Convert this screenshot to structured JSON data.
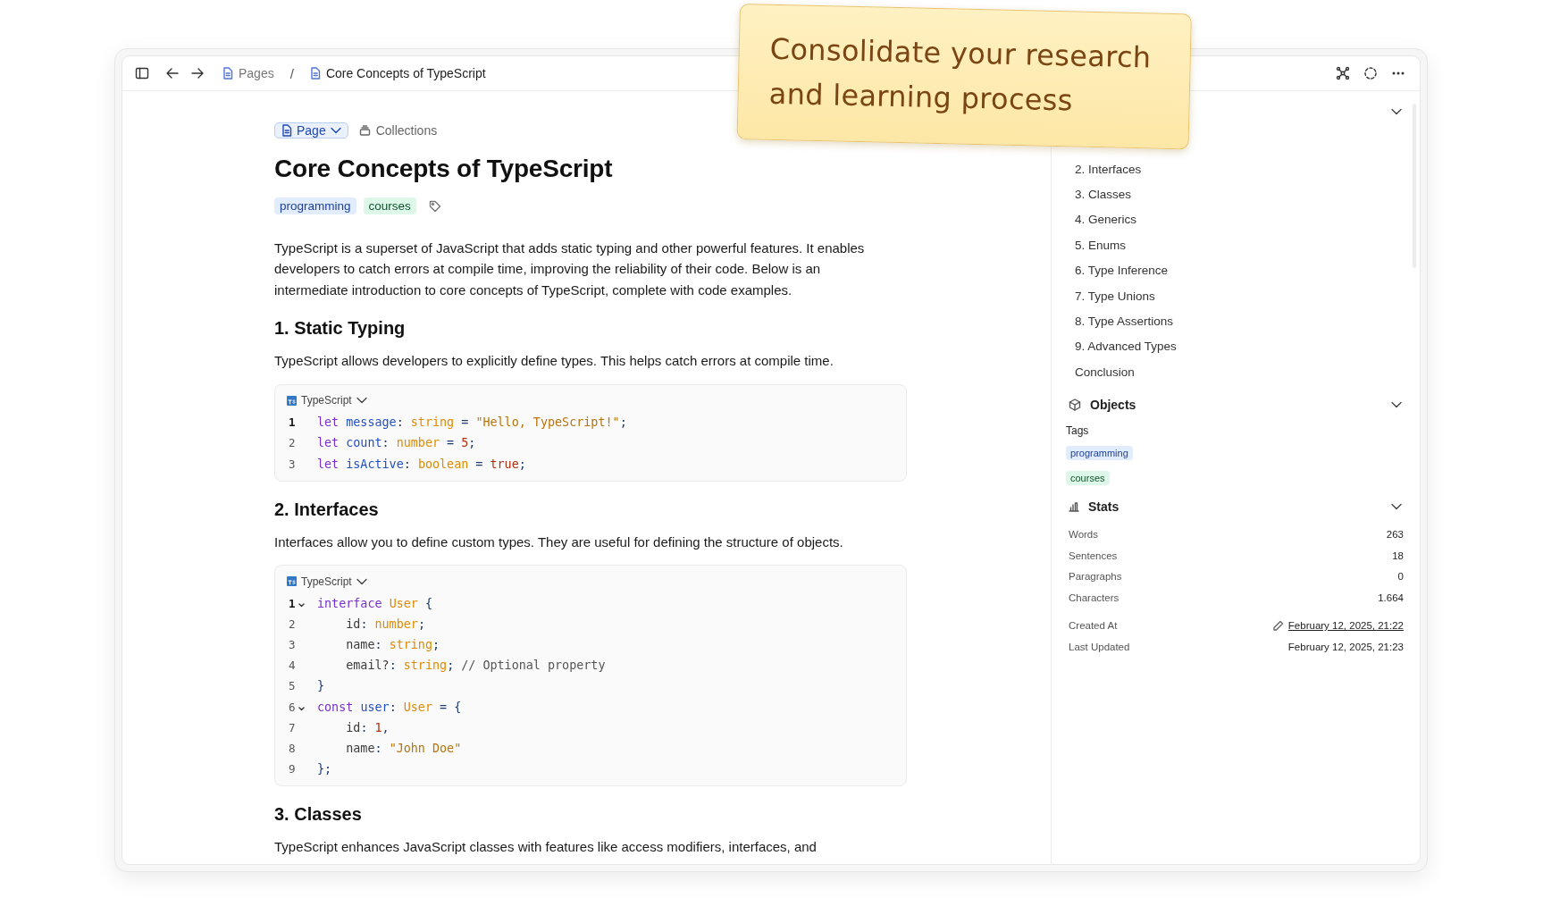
{
  "toolbar": {
    "breadcrumbs": [
      {
        "label": "Pages",
        "current": false
      },
      {
        "label": "Core Concepts of TypeScript",
        "current": true
      }
    ],
    "separator": "/"
  },
  "document": {
    "type_button": "Page",
    "collections": "Collections",
    "title": "Core Concepts of TypeScript",
    "tags": [
      {
        "label": "programming",
        "color": "#e1ecfd"
      },
      {
        "label": "courses",
        "color": "#ddf7e8"
      }
    ],
    "blocks": [
      {
        "kind": "paragraph",
        "text": "TypeScript is a superset of JavaScript that adds static typing and other powerful features. It enables developers to catch errors at compile time, improving the reliability of their code. Below is an intermediate introduction to core concepts of TypeScript, complete with code examples."
      },
      {
        "kind": "heading",
        "text": "1. Static Typing"
      },
      {
        "kind": "paragraph",
        "text": "TypeScript allows developers to explicitly define types. This helps catch errors at compile time."
      },
      {
        "kind": "code",
        "language": "TypeScript",
        "lines": [
          {
            "number": "1",
            "current": true,
            "foldable": false,
            "tokens": [
              {
                "kind": "keyword",
                "text": "let "
              },
              {
                "kind": "variable",
                "text": "message"
              },
              {
                "kind": "punct",
                "text": ": "
              },
              {
                "kind": "type",
                "text": "string"
              },
              {
                "kind": "punct",
                "text": " = "
              },
              {
                "kind": "string",
                "text": "\"Hello, TypeScript!\""
              },
              {
                "kind": "punct",
                "text": ";"
              }
            ]
          },
          {
            "number": "2",
            "current": false,
            "foldable": false,
            "tokens": [
              {
                "kind": "keyword",
                "text": "let "
              },
              {
                "kind": "variable",
                "text": "count"
              },
              {
                "kind": "punct",
                "text": ": "
              },
              {
                "kind": "type",
                "text": "number"
              },
              {
                "kind": "punct",
                "text": " = "
              },
              {
                "kind": "number",
                "text": "5"
              },
              {
                "kind": "punct",
                "text": ";"
              }
            ]
          },
          {
            "number": "3",
            "current": false,
            "foldable": false,
            "tokens": [
              {
                "kind": "keyword",
                "text": "let "
              },
              {
                "kind": "variable",
                "text": "isActive"
              },
              {
                "kind": "punct",
                "text": ": "
              },
              {
                "kind": "type",
                "text": "boolean"
              },
              {
                "kind": "punct",
                "text": " = "
              },
              {
                "kind": "number",
                "text": "true"
              },
              {
                "kind": "punct",
                "text": ";"
              }
            ]
          }
        ]
      },
      {
        "kind": "heading",
        "text": "2. Interfaces"
      },
      {
        "kind": "paragraph",
        "text": "Interfaces allow you to define custom types. They are useful for defining the structure of objects."
      },
      {
        "kind": "code",
        "language": "TypeScript",
        "lines": [
          {
            "number": "1",
            "current": true,
            "foldable": true,
            "tokens": [
              {
                "kind": "keyword",
                "text": "interface "
              },
              {
                "kind": "type",
                "text": "User"
              },
              {
                "kind": "punct",
                "text": " {"
              }
            ]
          },
          {
            "number": "2",
            "current": false,
            "foldable": false,
            "tokens": [
              {
                "kind": "plain",
                "text": "    id"
              },
              {
                "kind": "punct",
                "text": ": "
              },
              {
                "kind": "type",
                "text": "number"
              },
              {
                "kind": "punct",
                "text": ";"
              }
            ]
          },
          {
            "number": "3",
            "current": false,
            "foldable": false,
            "tokens": [
              {
                "kind": "plain",
                "text": "    name"
              },
              {
                "kind": "punct",
                "text": ": "
              },
              {
                "kind": "type",
                "text": "string"
              },
              {
                "kind": "punct",
                "text": ";"
              }
            ]
          },
          {
            "number": "4",
            "current": false,
            "foldable": false,
            "tokens": [
              {
                "kind": "plain",
                "text": "    email?"
              },
              {
                "kind": "punct",
                "text": ": "
              },
              {
                "kind": "type",
                "text": "string"
              },
              {
                "kind": "punct",
                "text": "; "
              },
              {
                "kind": "comment",
                "text": "// Optional property"
              }
            ]
          },
          {
            "number": "5",
            "current": false,
            "foldable": false,
            "tokens": [
              {
                "kind": "punct",
                "text": "}"
              }
            ]
          },
          {
            "number": "6",
            "current": false,
            "foldable": true,
            "tokens": [
              {
                "kind": "keyword",
                "text": "const "
              },
              {
                "kind": "variable",
                "text": "user"
              },
              {
                "kind": "punct",
                "text": ": "
              },
              {
                "kind": "type",
                "text": "User"
              },
              {
                "kind": "punct",
                "text": " = {"
              }
            ]
          },
          {
            "number": "7",
            "current": false,
            "foldable": false,
            "tokens": [
              {
                "kind": "plain",
                "text": "    id"
              },
              {
                "kind": "punct",
                "text": ": "
              },
              {
                "kind": "number",
                "text": "1"
              },
              {
                "kind": "punct",
                "text": ","
              }
            ]
          },
          {
            "number": "8",
            "current": false,
            "foldable": false,
            "tokens": [
              {
                "kind": "plain",
                "text": "    name"
              },
              {
                "kind": "punct",
                "text": ": "
              },
              {
                "kind": "string",
                "text": "\"John Doe\""
              }
            ]
          },
          {
            "number": "9",
            "current": false,
            "foldable": false,
            "tokens": [
              {
                "kind": "punct",
                "text": "};"
              }
            ]
          }
        ]
      },
      {
        "kind": "heading",
        "text": "3. Classes"
      },
      {
        "kind": "paragraph",
        "text": "TypeScript enhances JavaScript classes with features like access modifiers, interfaces, and"
      }
    ]
  },
  "sidebar": {
    "outline": {
      "expanded": true,
      "items": [
        "2. Interfaces",
        "3. Classes",
        "4. Generics",
        "5. Enums",
        "6. Type Inference",
        "7. Type Unions",
        "8. Type Assertions",
        "9. Advanced Types",
        "Conclusion"
      ]
    },
    "objects": {
      "title": "Objects",
      "expanded": true,
      "tags_label": "Tags",
      "tags": [
        {
          "label": "programming",
          "color": "#e1ecfd"
        },
        {
          "label": "courses",
          "color": "#ddf7e8"
        }
      ]
    },
    "stats": {
      "title": "Stats",
      "expanded": true,
      "rows": [
        {
          "label": "Words",
          "value": "263"
        },
        {
          "label": "Sentences",
          "value": "18"
        },
        {
          "label": "Paragraphs",
          "value": "0"
        },
        {
          "label": "Characters",
          "value": "1.664"
        }
      ],
      "dates": [
        {
          "label": "Created At",
          "value": "February 12, 2025, 21:22",
          "editable": true
        },
        {
          "label": "Last Updated",
          "value": "February 12, 2025, 21:23",
          "editable": false
        }
      ]
    }
  },
  "note": {
    "text": "Consolidate your research and learning process"
  }
}
